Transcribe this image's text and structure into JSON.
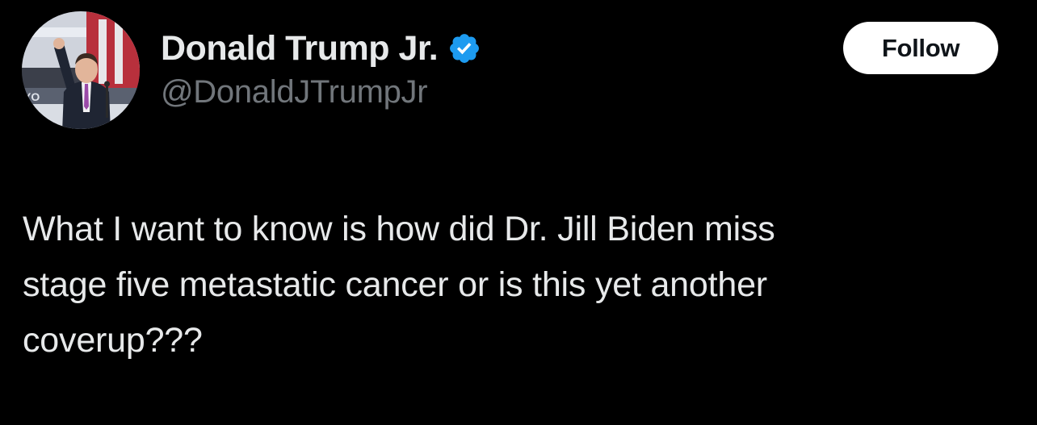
{
  "author": {
    "display_name": "Donald Trump Jr.",
    "handle": "@DonaldJTrumpJr",
    "verified": true,
    "avatar_icon": "profile-photo"
  },
  "follow_button": {
    "label": "Follow"
  },
  "tweet": {
    "lines": [
      "What I want to know is how did Dr. Jill Biden miss",
      "stage five metastatic cancer or is this yet another",
      "coverup???"
    ]
  },
  "colors": {
    "background": "#000000",
    "primary_text": "#e7e9ea",
    "secondary_text": "#71767b",
    "verified_badge": "#1d9bf0",
    "follow_button_bg": "#ffffff",
    "follow_button_text": "#0f1419"
  }
}
